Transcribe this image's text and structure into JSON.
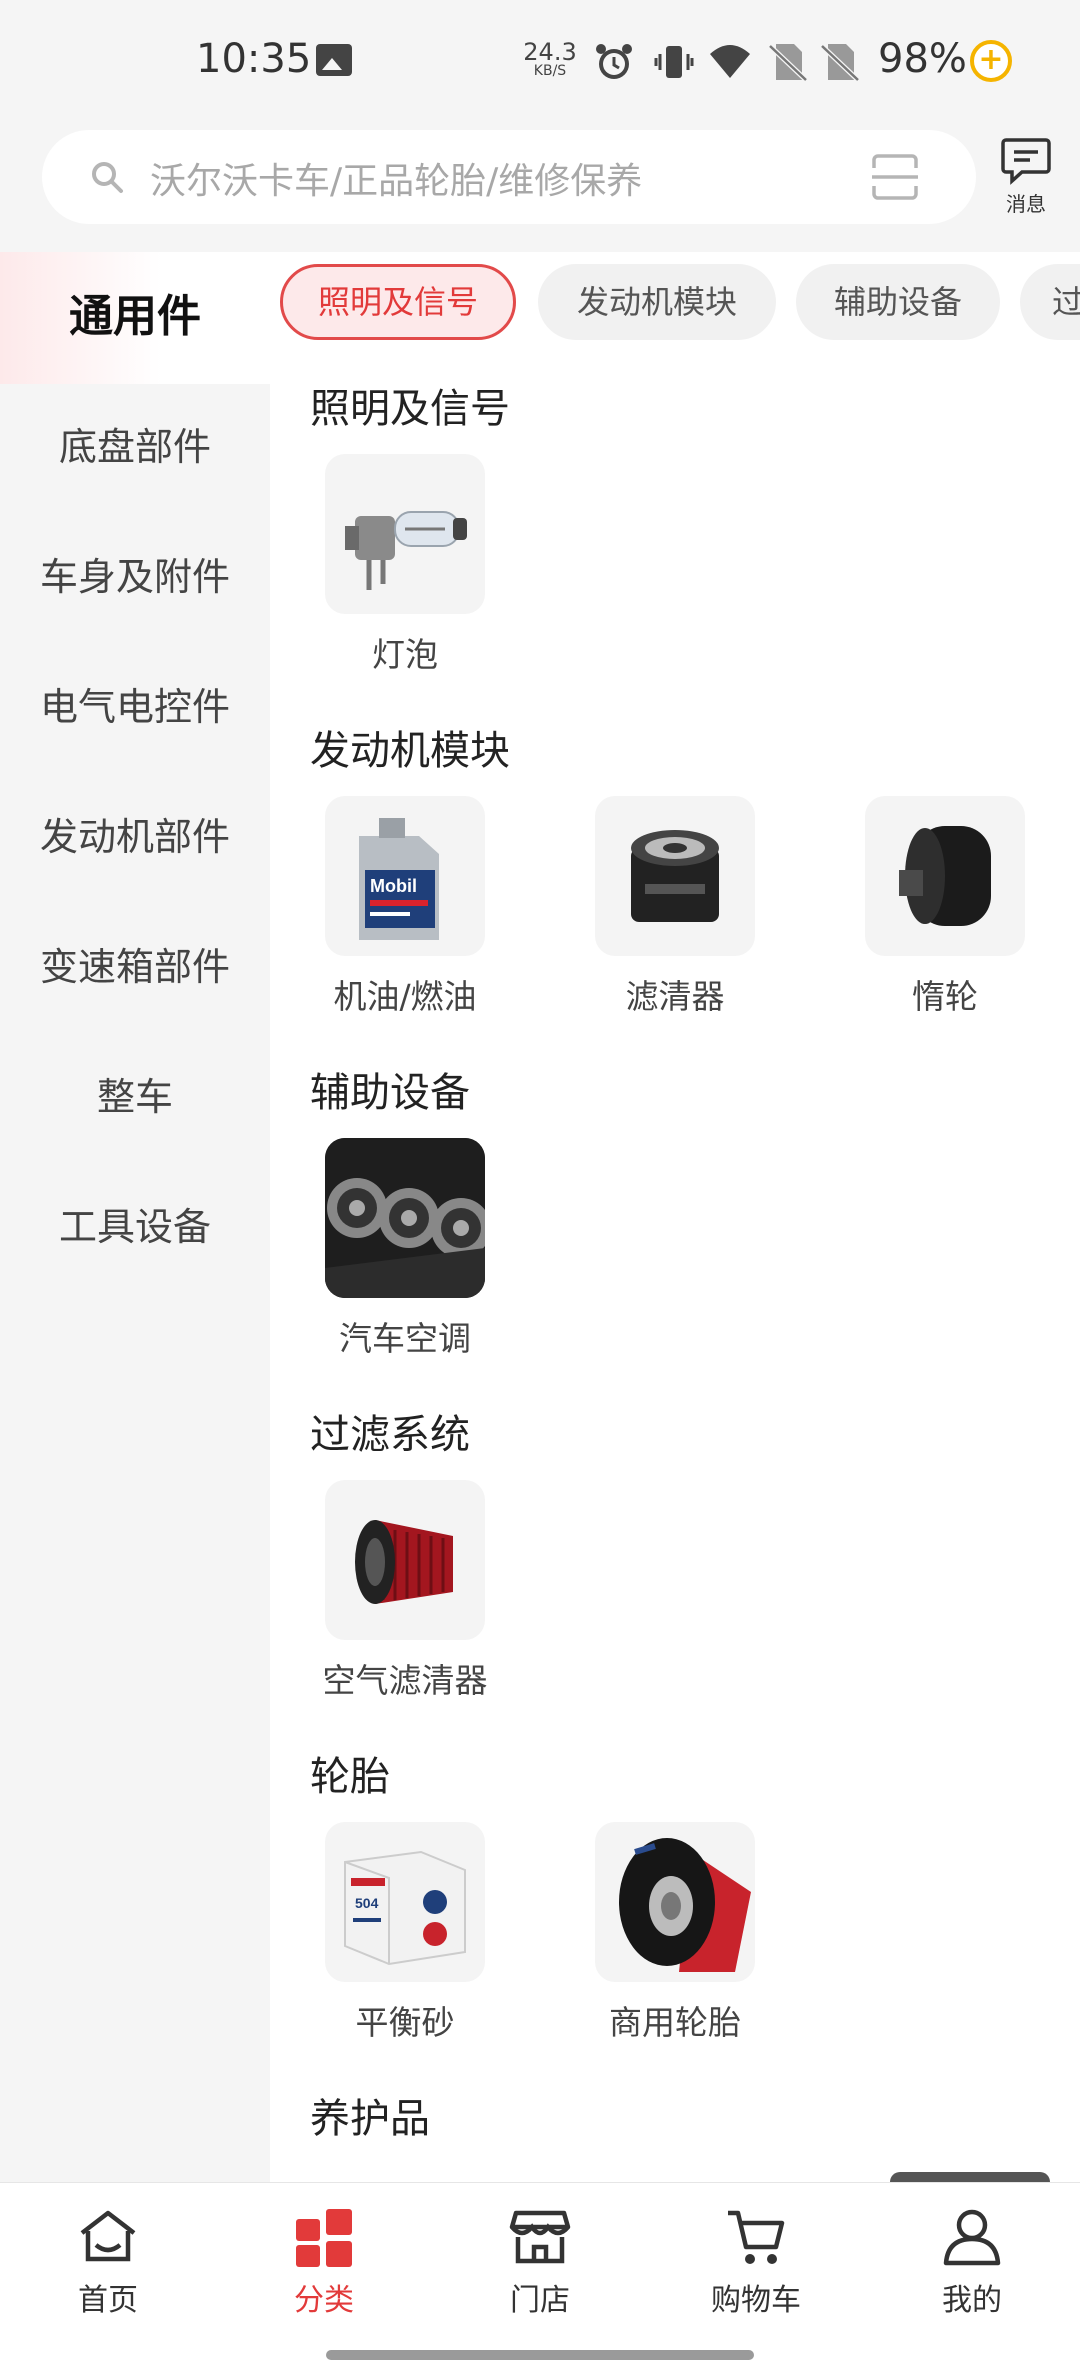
{
  "status": {
    "time": "10:35",
    "speed_value": "24.3",
    "speed_unit": "KB/S",
    "battery": "98%"
  },
  "search": {
    "placeholder": "沃尔沃卡车/正品轮胎/维修保养",
    "message_label": "消息"
  },
  "sidebar": {
    "items": [
      {
        "label": "通用件",
        "active": true
      },
      {
        "label": "底盘部件"
      },
      {
        "label": "车身及附件"
      },
      {
        "label": "电气电控件"
      },
      {
        "label": "发动机部件"
      },
      {
        "label": "变速箱部件"
      },
      {
        "label": "整车"
      },
      {
        "label": "工具设备"
      }
    ]
  },
  "chips": [
    {
      "label": "照明及信号",
      "active": true
    },
    {
      "label": "发动机模块"
    },
    {
      "label": "辅助设备"
    },
    {
      "label": "过"
    }
  ],
  "sections": [
    {
      "title": "照明及信号",
      "products": [
        {
          "label": "灯泡",
          "icon": "bulb-image"
        }
      ]
    },
    {
      "title": "发动机模块",
      "products": [
        {
          "label": "机油/燃油",
          "icon": "oil-bottle-image"
        },
        {
          "label": "滤清器",
          "icon": "oil-filter-image"
        },
        {
          "label": "惰轮",
          "icon": "idler-pulley-image"
        }
      ]
    },
    {
      "title": "辅助设备",
      "products": [
        {
          "label": "汽车空调",
          "icon": "air-vent-image"
        }
      ]
    },
    {
      "title": "过滤系统",
      "products": [
        {
          "label": "空气滤清器",
          "icon": "air-filter-image"
        }
      ]
    },
    {
      "title": "轮胎",
      "products": [
        {
          "label": "平衡砂",
          "icon": "balance-sand-image"
        },
        {
          "label": "商用轮胎",
          "icon": "truck-tire-image"
        }
      ]
    },
    {
      "title": "养护品",
      "products": []
    }
  ],
  "oil_brand": "Mobil",
  "balance_box_code": "504",
  "bottom_nav": [
    {
      "label": "首页",
      "icon": "home-icon"
    },
    {
      "label": "分类",
      "icon": "category-icon",
      "active": true
    },
    {
      "label": "门店",
      "icon": "store-icon"
    },
    {
      "label": "购物车",
      "icon": "cart-icon"
    },
    {
      "label": "我的",
      "icon": "profile-icon"
    }
  ],
  "colors": {
    "accent": "#e23a3a",
    "chip_active_bg": "#fde9ea",
    "sidebar_bg": "#f5f5f5"
  }
}
